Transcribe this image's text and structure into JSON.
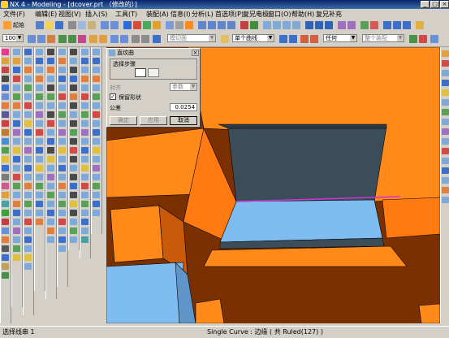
{
  "window": {
    "title": "NX 4 - Modeling - [dcover.prt （修改的）]",
    "min": "_",
    "max": "□",
    "close": "×"
  },
  "menubar": {
    "items": [
      "文件(F)",
      "编辑(E)",
      "视图(V)",
      "插入(S)",
      "工具(T)",
      "装配(A)",
      "信息(I)",
      "分析(L)",
      "首选项(P)",
      "复兄电极",
      "窗口(O)",
      "帮助(H)",
      "复兄补充"
    ]
  },
  "toolbar": {
    "start_label": "起始",
    "zoom_value": "100",
    "combo_filter": "模切面",
    "combo_curve": "单个曲线",
    "combo_any": "任何",
    "combo_assembly": "整个装配"
  },
  "dialog": {
    "title": "直纹曲",
    "section_label": "选择步骤",
    "align_label": "对齐",
    "align_value": "参数",
    "keep_shape_label": "保留形状",
    "tolerance_label": "公差",
    "tolerance_value": "0.0254",
    "ok_label": "确定",
    "apply_label": "应用",
    "cancel_label": "取消"
  },
  "statusbar": {
    "left_text": "选择线串 1",
    "right_text": "Single Curve : 边缘 ( 共 Ruled(127) )"
  },
  "colors": {
    "title_bar": "#0a246a",
    "face_orange": "#ff8a1a",
    "face_brown": "#7a3000",
    "face_blue": "#7fbcef",
    "face_slate": "#3c4d5a",
    "highlight": "#cc33cc"
  }
}
